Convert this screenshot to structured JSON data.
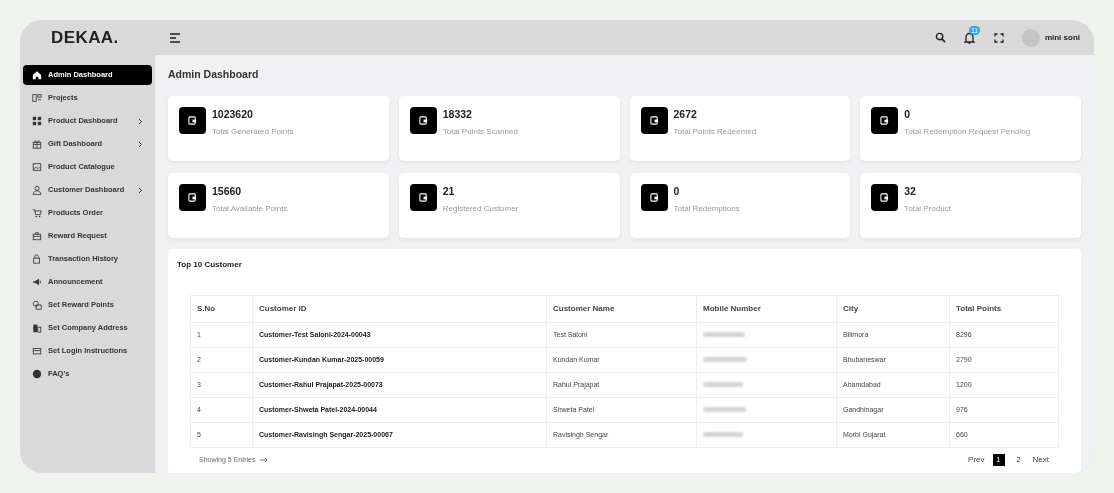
{
  "logo": "DEKAA.",
  "header": {
    "notifications": "11",
    "user": "mini soni"
  },
  "sidebar": {
    "items": [
      {
        "label": "Admin Dashboard",
        "selected": true,
        "expandable": false
      },
      {
        "label": "Projects",
        "selected": false,
        "expandable": false
      },
      {
        "label": "Product Dashboard",
        "selected": false,
        "expandable": true
      },
      {
        "label": "Gift Dashboard",
        "selected": false,
        "expandable": true
      },
      {
        "label": "Product Catalogue",
        "selected": false,
        "expandable": false
      },
      {
        "label": "Customer Dashboard",
        "selected": false,
        "expandable": true
      },
      {
        "label": "Products Order",
        "selected": false,
        "expandable": false
      },
      {
        "label": "Reward Request",
        "selected": false,
        "expandable": false
      },
      {
        "label": "Transaction History",
        "selected": false,
        "expandable": false
      },
      {
        "label": "Announcement",
        "selected": false,
        "expandable": false
      },
      {
        "label": "Set Reward Points",
        "selected": false,
        "expandable": false
      },
      {
        "label": "Set Company Address",
        "selected": false,
        "expandable": false
      },
      {
        "label": "Set Login Instructions",
        "selected": false,
        "expandable": false
      },
      {
        "label": "FAQ's",
        "selected": false,
        "expandable": false
      }
    ]
  },
  "page_title": "Admin Dashboard",
  "stats": [
    {
      "value": "1023620",
      "label": "Total Generated Points"
    },
    {
      "value": "18332",
      "label": "Total Points Scanned"
    },
    {
      "value": "2672",
      "label": "Total Points Redeemed"
    },
    {
      "value": "0",
      "label": "Total Redemption Request Pending"
    },
    {
      "value": "15660",
      "label": "Total Available Points"
    },
    {
      "value": "21",
      "label": "Registered Customer"
    },
    {
      "value": "0",
      "label": "Total Redemptions"
    },
    {
      "value": "32",
      "label": "Total Product"
    }
  ],
  "table": {
    "title": "Top 10 Customer",
    "columns": [
      "S.No",
      "Customer ID",
      "Customer Name",
      "Mobile Number",
      "City",
      "Total Points"
    ],
    "rows": [
      {
        "sno": "1",
        "customer_id": "Customer-Test Saloni-2024-00043",
        "name": "Test Saloni",
        "city": "Bilimora",
        "points": "8296"
      },
      {
        "sno": "2",
        "customer_id": "Customer-Kundan Kumar-2025-00059",
        "name": "Kundan Kumar",
        "city": "Bhubaneswar",
        "points": "2790"
      },
      {
        "sno": "3",
        "customer_id": "Customer-Rahul Prajapat-2025-00073",
        "name": "Rahul Prajapat",
        "city": "Ahamdabad",
        "points": "1200"
      },
      {
        "sno": "4",
        "customer_id": "Customer-Shweta Patel-2024-00044",
        "name": "Shweta Patel",
        "city": "Gandhinagar",
        "points": "976"
      },
      {
        "sno": "5",
        "customer_id": "Customer-Ravisingh Sengar-2025-00067",
        "name": "Ravisingh Sengar",
        "city": "Morbi Gujarat",
        "points": "660"
      }
    ],
    "footer": "Showing 5 Entries",
    "pagination": {
      "prev": "Prev",
      "pages": [
        {
          "label": "1",
          "selected": true
        },
        {
          "label": "2",
          "selected": false
        }
      ],
      "next": "Next"
    }
  }
}
